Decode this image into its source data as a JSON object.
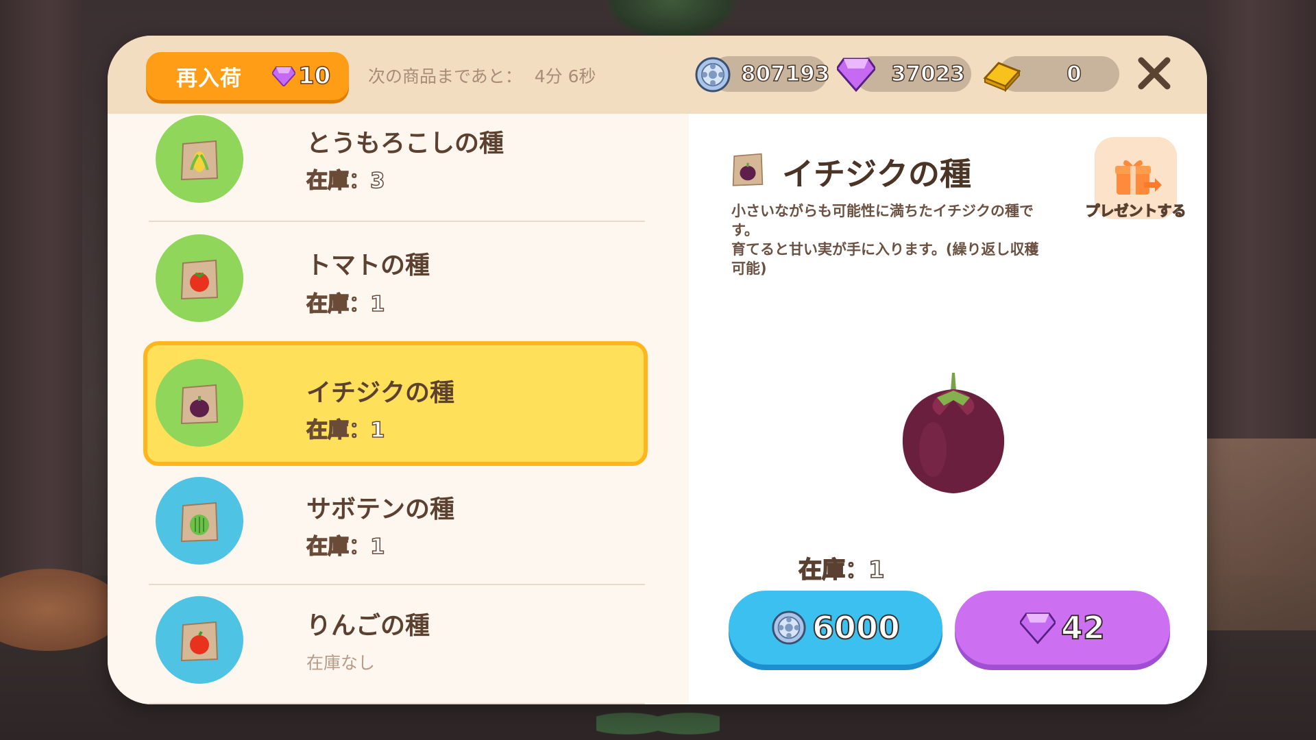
{
  "shop": {
    "restock": {
      "label": "再入荷",
      "cost": "10",
      "currency_icon": "gem-icon"
    },
    "next_item": {
      "label": "次の商品まであと：",
      "time": "4分 6秒"
    },
    "currencies": {
      "coins": {
        "icon": "coin-icon",
        "value": "807193"
      },
      "gems": {
        "icon": "gem-icon",
        "value": "37023"
      },
      "gold": {
        "icon": "gold-bar-icon",
        "value": "0"
      }
    },
    "close_icon": "close-icon"
  },
  "items": [
    {
      "name": "とうもろこしの種",
      "stock": "在庫：3",
      "icon": "corn-seed-icon",
      "circle_color": "#8fd65a"
    },
    {
      "name": "トマトの種",
      "stock": "在庫：1",
      "icon": "tomato-seed-icon",
      "circle_color": "#8fd65a"
    },
    {
      "name": "イチジクの種",
      "stock": "在庫：1",
      "icon": "fig-seed-icon",
      "circle_color": "#8fd65a",
      "selected": true
    },
    {
      "name": "サボテンの種",
      "stock": "在庫：1",
      "icon": "cactus-seed-icon",
      "circle_color": "#4fc3e3"
    },
    {
      "name": "りんごの種",
      "stock": "在庫なし",
      "icon": "apple-seed-icon",
      "circle_color": "#4fc3e3"
    }
  ],
  "detail": {
    "title": "イチジクの種",
    "description": "小さいながらも可能性に満ちたイチジクの種です。\n育てると甘い実が手に入ります。(繰り返し収穫可能)",
    "present_label": "プレゼントする",
    "stock": "在庫：1",
    "price_coins": "6000",
    "price_gems": "42"
  },
  "colors": {
    "restock_orange": "#ff9d17",
    "selected_yellow": "#ffe05a",
    "coin_button": "#3cc0ef",
    "gem_button": "#cc6ff0"
  }
}
